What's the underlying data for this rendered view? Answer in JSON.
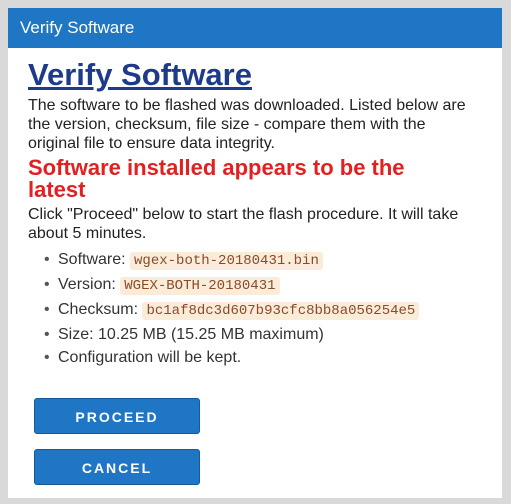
{
  "window": {
    "title": "Verify Software"
  },
  "page": {
    "heading": "Verify Software",
    "intro": "The software to be flashed was downloaded. Listed below are the version, checksum, file size - compare them with the original file to ensure data integrity.",
    "status": "Software installed appears to be the latest",
    "instructions": "Click \"Proceed\" below to start the flash procedure. It will take about 5 minutes."
  },
  "details": {
    "software_label": "Software: ",
    "software_value": "wgex-both-20180431.bin",
    "version_label": "Version: ",
    "version_value": "WGEX-BOTH-20180431",
    "checksum_label": "Checksum: ",
    "checksum_value": "bc1af8dc3d607b93cfc8bb8a056254e5",
    "size_text": "Size: 10.25 MB (15.25 MB maximum)",
    "config_text": "Configuration will be kept."
  },
  "buttons": {
    "proceed": "PROCEED",
    "cancel": "CANCEL"
  },
  "colors": {
    "accent": "#1f76c4",
    "heading": "#1e3a8a",
    "status": "#e32021",
    "code_bg": "#fbecd9"
  }
}
